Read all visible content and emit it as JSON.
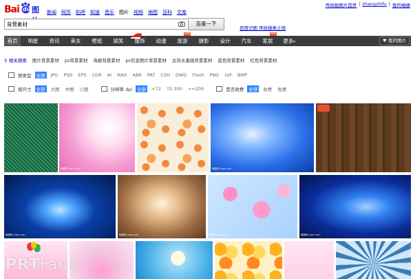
{
  "logo": {
    "bai": "Bai",
    "du": "du",
    "tupian": "图片"
  },
  "top_nav": [
    "新闻",
    "网页",
    "贴吧",
    "知道",
    "音乐",
    "图片",
    "视频",
    "地图",
    "百科",
    "文库"
  ],
  "top_nav_current": "图片",
  "user_links": {
    "home": "传统版图片首页",
    "sep1": "|",
    "username": "zhangzhifu",
    "sep2": "|",
    "settings": "我的相册"
  },
  "search": {
    "value": "背景素材",
    "button_label": "百度一下",
    "upload_label": "百度识图 传统搜索之旅"
  },
  "channels": {
    "items": [
      "首页",
      "明星",
      "资讯",
      "美女",
      "壁纸",
      "搞笑",
      "服饰",
      "动漫",
      "旅游",
      "摄影",
      "设计",
      "汽车",
      "家居",
      "更多"
    ],
    "active": "首页",
    "new_tag": "NEW",
    "my_pictures": "我的图片"
  },
  "related": {
    "heading": "相关搜索",
    "items": [
      "图片背景素材",
      "ps背景素材",
      "海报背景素材",
      "ps信息图片背景素材",
      "古风水墨画背景素材",
      "蓝色背景素材",
      "红色背景素材"
    ]
  },
  "filters": {
    "format": {
      "label": "按类型",
      "options": [
        "全部",
        "JPG",
        "PSD",
        "EPS",
        "CDR",
        "AI",
        "MAX",
        "ABR",
        "PAT",
        "CSH",
        "DWG",
        "Flash",
        "PNG",
        "GIF",
        "BMP"
      ]
    },
    "size": {
      "label": "按尺寸",
      "options": [
        "全部",
        "大图",
        "中图",
        "小图"
      ]
    },
    "dpi": {
      "label": "分辨率 dpi",
      "options": [
        "全部",
        "<72",
        "72-300",
        ">=200"
      ]
    },
    "charge": {
      "label": "是否收费",
      "options": [
        "全部",
        "收费",
        "免费"
      ]
    }
  },
  "tile_watermark": "昵图网 nipic.com",
  "page_watermark": {
    "part1": "PRT",
    "part2": "Fans"
  },
  "colors": {
    "brand_red": "#e10602",
    "brand_blue": "#2932e1",
    "nav_bg": "#3b3c3e",
    "selected": "#3385ff"
  }
}
